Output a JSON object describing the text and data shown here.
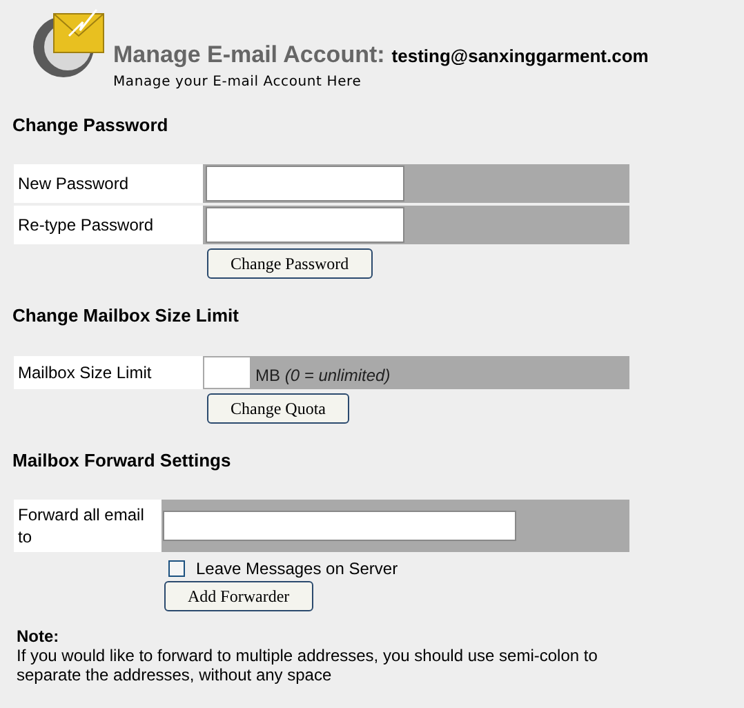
{
  "header": {
    "title": "Manage E-mail Account:",
    "account": "testing@sanxinggarment.com",
    "subtitle": "Manage your E-mail Account Here"
  },
  "sections": [
    {
      "heading": "Change Password",
      "rows": [
        {
          "label": "New Password",
          "kind": "password"
        },
        {
          "label": "Re-type Password",
          "kind": "password"
        }
      ],
      "button": "Change Password"
    },
    {
      "heading": "Change Mailbox Size Limit",
      "rows": [
        {
          "label": "Mailbox Size Limit",
          "kind": "quota",
          "unit": "MB",
          "hint": "(0 = unlimited)"
        }
      ],
      "button": "Change Quota"
    },
    {
      "heading": "Mailbox Forward Settings",
      "rows": [
        {
          "label": "Forward all email to",
          "kind": "forward"
        }
      ],
      "checkbox": {
        "label": "Leave Messages on Server",
        "checked": false
      },
      "button": "Add Forwarder"
    }
  ],
  "note": {
    "title": "Note:",
    "text": "If you would like to forward to multiple addresses, you should use semi-colon to separate the addresses, without any space"
  }
}
